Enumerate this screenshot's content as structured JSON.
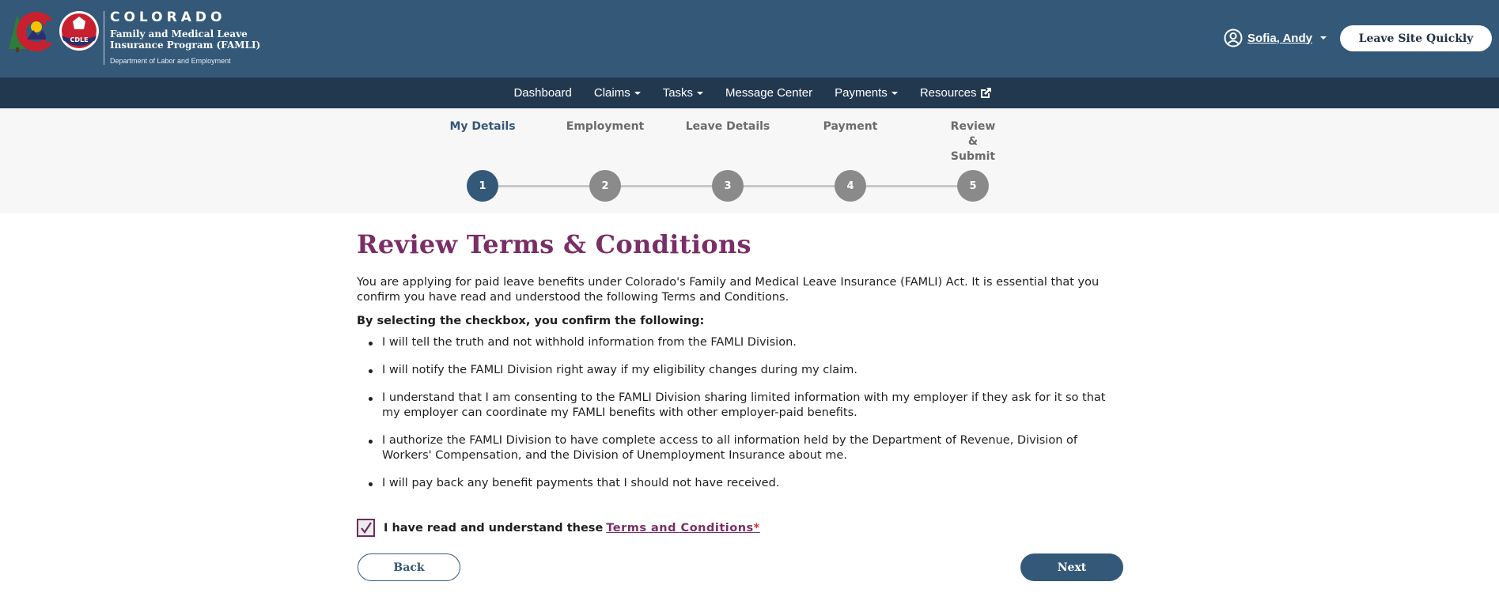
{
  "header": {
    "brand_title": "COLORADO",
    "brand_subtitle": "Family and Medical Leave Insurance Program (FAMLI)",
    "brand_department": "Department of Labor and Employment",
    "cdle_badge": "CDLE",
    "user_name": "Sofia, Andy",
    "leave_site_label": "Leave Site Quickly"
  },
  "nav": {
    "items": [
      {
        "label": "Dashboard",
        "dropdown": false
      },
      {
        "label": "Claims",
        "dropdown": true
      },
      {
        "label": "Tasks",
        "dropdown": true
      },
      {
        "label": "Message Center",
        "dropdown": false
      },
      {
        "label": "Payments",
        "dropdown": true
      },
      {
        "label": "Resources",
        "external": true
      }
    ]
  },
  "stepper": {
    "current_step": 1,
    "steps": [
      {
        "number": "1",
        "label": "My Details"
      },
      {
        "number": "2",
        "label": "Employment"
      },
      {
        "number": "3",
        "label": "Leave Details"
      },
      {
        "number": "4",
        "label": "Payment"
      },
      {
        "number": "5",
        "label": "Review & Submit"
      }
    ]
  },
  "main": {
    "title": "Review Terms & Conditions",
    "intro": "You are applying for paid leave benefits under Colorado's Family and Medical Leave Insurance (FAMLI) Act. It is essential that you confirm you have read and understood the following Terms and Conditions.",
    "confirm_heading": "By selecting the checkbox, you confirm the following:",
    "terms": [
      "I will tell the truth and not withhold information from the FAMLI Division.",
      "I will notify the FAMLI Division right away if my eligibility changes during my claim.",
      "I understand that I am consenting to the FAMLI Division sharing limited information with my employer if they ask for it so that my employer can coordinate my FAMLI benefits with other employer-paid benefits.",
      "I authorize the FAMLI Division to have complete access to all information held by the Department of Revenue, Division of Workers' Compensation, and the Division of Unemployment Insurance about me.",
      "I will pay back any benefit payments that I should not have received."
    ],
    "checkbox": {
      "checked": true,
      "label": "I have read and understand these",
      "link_text": "Terms and Conditions",
      "required_marker": "*"
    },
    "back_label": "Back",
    "next_label": "Next"
  },
  "colors": {
    "header_bg": "#345878",
    "nav_bg": "#22384f",
    "title_accent": "#7a2e67",
    "active_step": "#345878",
    "inactive_step": "#8a8a8a"
  }
}
